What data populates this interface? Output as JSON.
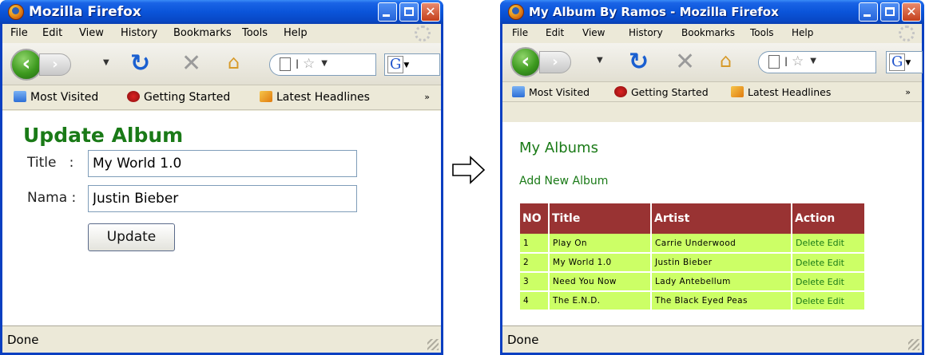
{
  "windows": [
    {
      "title": "Mozilla Firefox",
      "menu": [
        "File",
        "Edit",
        "View",
        "History",
        "Bookmarks",
        "Tools",
        "Help"
      ],
      "address_text": "l",
      "search_letter": "G",
      "bookmarks": [
        "Most Visited",
        "Getting Started",
        "Latest Headlines"
      ],
      "bookmarks_overflow": "»",
      "page": {
        "heading": "Update Album",
        "title_label": "Title",
        "title_sep": ":",
        "title_value": "My World 1.0",
        "nama_label": "Nama",
        "nama_sep": ":",
        "nama_value": "Justin Bieber",
        "update_button": "Update"
      },
      "status": "Done"
    },
    {
      "title": "My Album By Ramos - Mozilla Firefox",
      "menu": [
        "File",
        "Edit",
        "View",
        "History",
        "Bookmarks",
        "Tools",
        "Help"
      ],
      "address_text": "l",
      "search_letter": "G",
      "bookmarks": [
        "Most Visited",
        "Getting Started",
        "Latest Headlines"
      ],
      "bookmarks_overflow": "»",
      "page": {
        "heading": "My Albums",
        "add_link": "Add New Album",
        "table": {
          "headers": [
            "NO",
            "Title",
            "Artist",
            "Action"
          ],
          "rows": [
            {
              "no": "1",
              "title": "Play On",
              "artist": "Carrie Underwood",
              "delete": "Delete",
              "edit": "Edit"
            },
            {
              "no": "2",
              "title": "My World 1.0",
              "artist": "Justin Bieber",
              "delete": "Delete",
              "edit": "Edit"
            },
            {
              "no": "3",
              "title": "Need You Now",
              "artist": "Lady Antebellum",
              "delete": "Delete",
              "edit": "Edit"
            },
            {
              "no": "4",
              "title": "The E.N.D.",
              "artist": "The Black Eyed Peas",
              "delete": "Delete",
              "edit": "Edit"
            }
          ]
        }
      },
      "status": "Done"
    }
  ],
  "colors": {
    "titlebar": "#0a54d9",
    "heading_green": "#1a7a17",
    "table_header": "#993333",
    "table_row": "#ccff66"
  },
  "icons": {
    "arrow": "right-arrow-icon",
    "back": "back-arrow-icon",
    "forward": "forward-arrow-icon",
    "reload": "reload-icon",
    "stop": "stop-icon",
    "home": "home-icon",
    "bookmark_star": "star-icon"
  }
}
